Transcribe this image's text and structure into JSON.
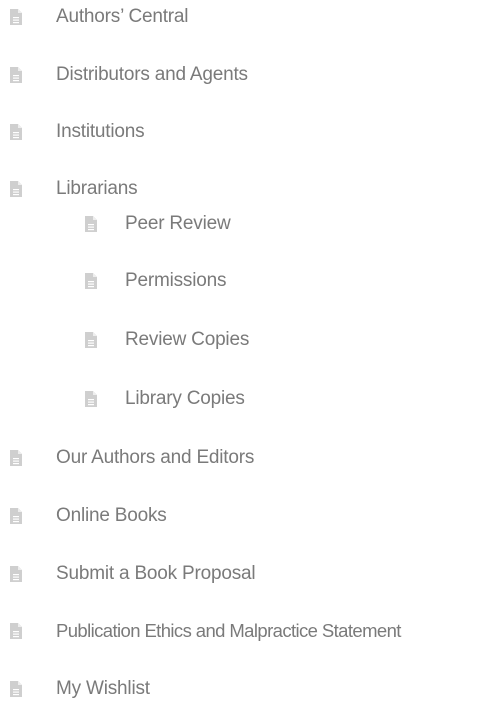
{
  "menu": {
    "icon": "document-icon",
    "icon_color": "#cfcfcf",
    "text_color": "#7a7a7a",
    "items": [
      {
        "label": "Authors’ Central"
      },
      {
        "label": "Distributors and Agents"
      },
      {
        "label": "Institutions"
      },
      {
        "label": "Librarians",
        "children": [
          {
            "label": "Peer Review"
          },
          {
            "label": "Permissions"
          },
          {
            "label": "Review Copies"
          },
          {
            "label": "Library Copies"
          }
        ]
      },
      {
        "label": "Our Authors and Editors"
      },
      {
        "label": "Online Books"
      },
      {
        "label": "Submit a Book Proposal"
      },
      {
        "label": "Publication Ethics and Malpractice Statement"
      },
      {
        "label": "My Wishlist"
      }
    ]
  }
}
